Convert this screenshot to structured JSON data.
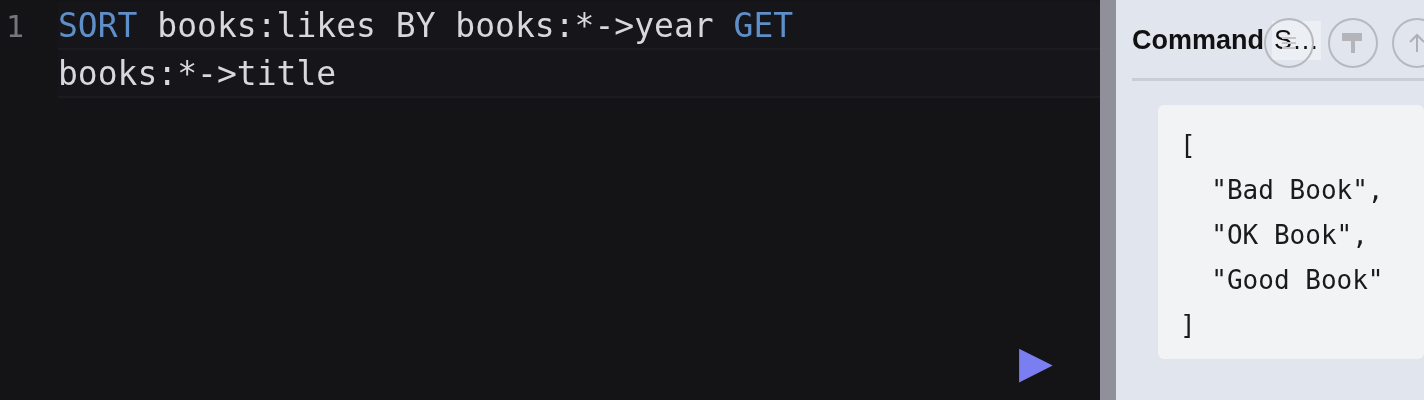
{
  "editor": {
    "rows": [
      {
        "line_number": "1",
        "tokens": [
          {
            "kind": "keyword",
            "text": "SORT"
          },
          {
            "kind": "plain",
            "text": " books:likes BY books:*->year "
          },
          {
            "kind": "keyword",
            "text": "GET"
          }
        ]
      },
      {
        "tokens": [
          {
            "kind": "plain",
            "text": "books:*->title"
          }
        ]
      }
    ],
    "run_button": "▶"
  },
  "result_panel": {
    "title": "Command",
    "tab": "S…",
    "result_lines": [
      "[",
      "  \"Bad Book\",",
      "  \"OK Book\",",
      "  \"Good Book\"",
      "]"
    ]
  }
}
